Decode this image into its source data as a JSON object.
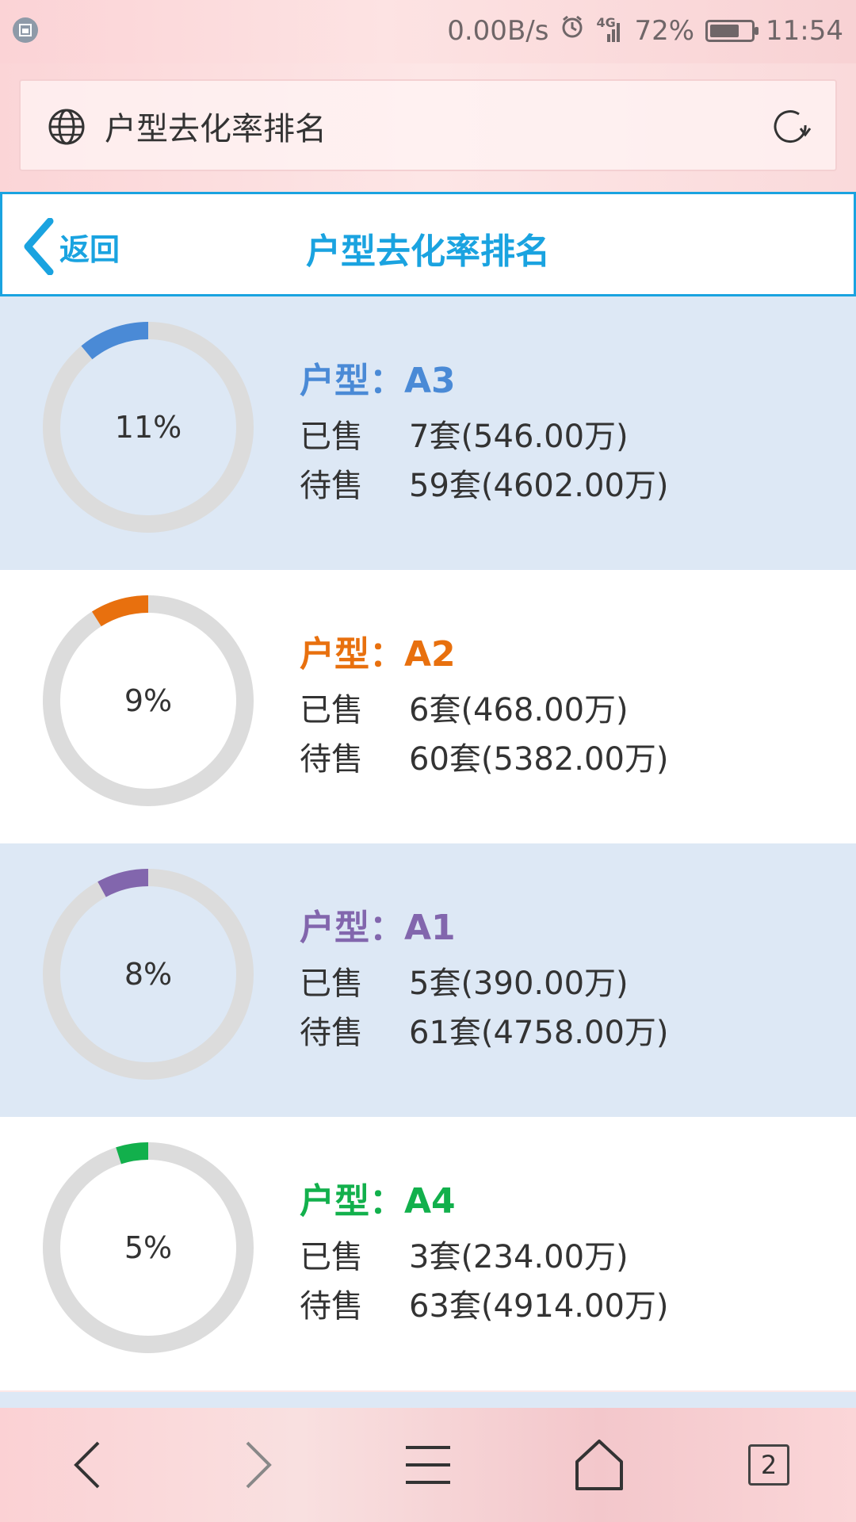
{
  "status_bar": {
    "network_speed": "0.00B/s",
    "signal_label": "4G",
    "battery_percent": "72%",
    "battery_level": 0.72,
    "time": "11:54"
  },
  "browser": {
    "address_text": "户型去化率排名"
  },
  "header": {
    "back_label": "返回",
    "title": "户型去化率排名"
  },
  "rows": [
    {
      "type_label": "户型：",
      "type_code": "A3",
      "percent": "11%",
      "percent_value": 11,
      "color": "#4a8ad6",
      "bg": "alt",
      "sold_label": "已售",
      "sold_value": "7套(546.00万)",
      "unsold_label": "待售",
      "unsold_value": "59套(4602.00万)"
    },
    {
      "type_label": "户型：",
      "type_code": "A2",
      "percent": "9%",
      "percent_value": 9,
      "color": "#e8700e",
      "bg": "plain",
      "sold_label": "已售",
      "sold_value": "6套(468.00万)",
      "unsold_label": "待售",
      "unsold_value": "60套(5382.00万)"
    },
    {
      "type_label": "户型：",
      "type_code": "A1",
      "percent": "8%",
      "percent_value": 8,
      "color": "#8266ad",
      "bg": "alt",
      "sold_label": "已售",
      "sold_value": "5套(390.00万)",
      "unsold_label": "待售",
      "unsold_value": "61套(4758.00万)"
    },
    {
      "type_label": "户型：",
      "type_code": "A4",
      "percent": "5%",
      "percent_value": 5,
      "color": "#12b04c",
      "bg": "plain",
      "sold_label": "已售",
      "sold_value": "3套(234.00万)",
      "unsold_label": "待售",
      "unsold_value": "63套(4914.00万)"
    }
  ],
  "bottom_nav": {
    "tab_count": "2",
    "icons": [
      "back-arrow-icon",
      "forward-arrow-icon",
      "menu-icon",
      "home-icon",
      "tabs-icon"
    ]
  },
  "colors": {
    "accent": "#1aa3e0",
    "donut_track": "#dcdcdc",
    "alt_row_bg": "#dde8f5"
  }
}
